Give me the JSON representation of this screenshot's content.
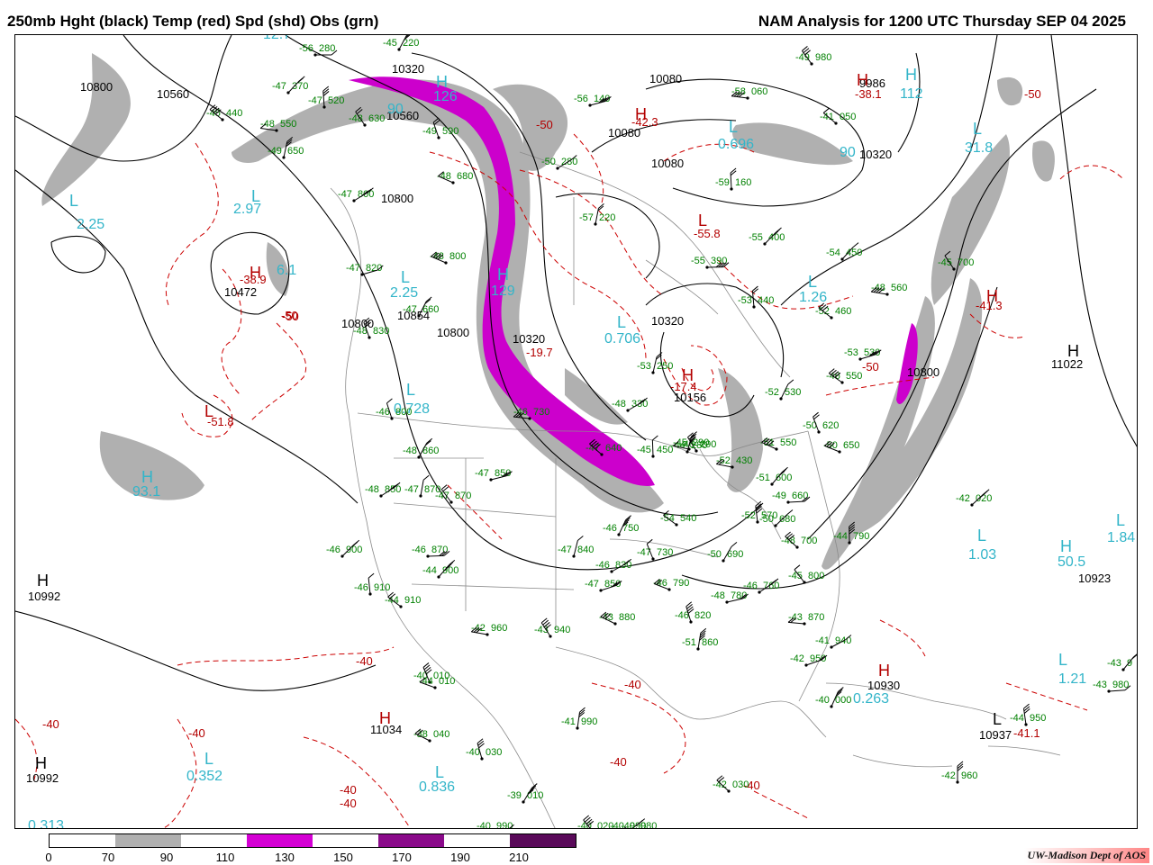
{
  "header": {
    "title_left": "250mb Hght (black) Temp (red) Spd (shd) Obs (grn)",
    "title_right": "NAM Analysis for 1200 UTC Thursday  SEP 04 2025"
  },
  "legend": {
    "ticks": [
      "0",
      "70",
      "90",
      "110",
      "130",
      "150",
      "170",
      "190",
      "210"
    ],
    "colors": [
      "#ffffff",
      "#b0b0b0",
      "#ffffff",
      "#d400d4",
      "#ffffff",
      "#8a0a8a",
      "#ffffff",
      "#5a0a5a"
    ]
  },
  "credit": "UW-Madison  Dept of AOS",
  "colors": {
    "height": "#000000",
    "temp": "#cc0000",
    "obs": "#008000",
    "cyan": "#33b5c9",
    "gray": "#b0b0b0",
    "magenta": "#cc00cc"
  },
  "height_labels": [
    "10800",
    "10560",
    "10320",
    "10560",
    "10800",
    "10472",
    "10800",
    "10854",
    "10800",
    "10320",
    "10080",
    "10080",
    "10080",
    "9986",
    "10320",
    "10156",
    "10320",
    "10800",
    "11022",
    "10923",
    "10992",
    "10930",
    "10992",
    "11034",
    "10937"
  ],
  "temp_labels": [
    "-50",
    "-42.3",
    "-55.8",
    "-38.1",
    "-41.3",
    "-50",
    "-17.4",
    "-38.9",
    "-50",
    "-50",
    "-51.8",
    "-40",
    "-40",
    "-40",
    "-40",
    "-40",
    "-40",
    "-40",
    "-41.1",
    "-40",
    "-50",
    "-19.7"
  ],
  "cyan_labels": [
    "12.7",
    "2.25",
    "2.97",
    "2.25",
    "0.728",
    "93.1",
    "0.352",
    "0.836",
    "0.313",
    "0.706",
    "0.696",
    "1.26",
    "31.8",
    "1.03",
    "50.5",
    "1.84",
    "1.21",
    "0.263",
    "126",
    "129",
    "6.1",
    "112",
    "90",
    "90"
  ],
  "obs": [
    {
      "t": "-56",
      "v": "280"
    },
    {
      "t": "-47",
      "v": "370"
    },
    {
      "t": "-47",
      "v": "520"
    },
    {
      "t": "-45",
      "v": "440"
    },
    {
      "t": "-48",
      "v": "550"
    },
    {
      "t": "-48",
      "v": "630"
    },
    {
      "t": "-49",
      "v": "650"
    },
    {
      "t": "-47",
      "v": "800"
    },
    {
      "t": "-47",
      "v": "820"
    },
    {
      "t": "-47",
      "v": "660"
    },
    {
      "t": "-48",
      "v": "830"
    },
    {
      "t": "-48",
      "v": "800"
    },
    {
      "t": "-48",
      "v": "680"
    },
    {
      "t": "-49",
      "v": "590"
    },
    {
      "t": "-45",
      "v": "220"
    },
    {
      "t": "-56",
      "v": "140"
    },
    {
      "t": "-50",
      "v": "280"
    },
    {
      "t": "-57",
      "v": "220"
    },
    {
      "t": "-49",
      "v": "980"
    },
    {
      "t": "-58",
      "v": "060"
    },
    {
      "t": "-41",
      "v": "050"
    },
    {
      "t": "-59",
      "v": "160"
    },
    {
      "t": "-55",
      "v": "400"
    },
    {
      "t": "-55",
      "v": "390"
    },
    {
      "t": "-54",
      "v": "450"
    },
    {
      "t": "-53",
      "v": "440"
    },
    {
      "t": "-52",
      "v": "460"
    },
    {
      "t": "-48",
      "v": "560"
    },
    {
      "t": "-45",
      "v": "700"
    },
    {
      "t": "-53",
      "v": "250"
    },
    {
      "t": "-48",
      "v": "330"
    },
    {
      "t": "-53",
      "v": "530"
    },
    {
      "t": "-52",
      "v": "530"
    },
    {
      "t": "-50",
      "v": "620"
    },
    {
      "t": "-50",
      "v": "650"
    },
    {
      "t": "-51",
      "v": "550"
    },
    {
      "t": "-46",
      "v": "800"
    },
    {
      "t": "-48",
      "v": "860"
    },
    {
      "t": "-47",
      "v": "850"
    },
    {
      "t": "-48",
      "v": "850"
    },
    {
      "t": "-47",
      "v": "870"
    },
    {
      "t": "-47",
      "v": "870"
    },
    {
      "t": "-46",
      "v": "730"
    },
    {
      "t": "-47",
      "v": "640"
    },
    {
      "t": "-45",
      "v": "450"
    },
    {
      "t": "-46",
      "v": "900"
    },
    {
      "t": "-46",
      "v": "870"
    },
    {
      "t": "-44",
      "v": "900"
    },
    {
      "t": "-46",
      "v": "910"
    },
    {
      "t": "-44",
      "v": "910"
    },
    {
      "t": "-42",
      "v": "960"
    },
    {
      "t": "-43",
      "v": "940"
    },
    {
      "t": "-47",
      "v": "840"
    },
    {
      "t": "-46",
      "v": "830"
    },
    {
      "t": "-47",
      "v": "850"
    },
    {
      "t": "-46",
      "v": "750"
    },
    {
      "t": "-47",
      "v": "730"
    },
    {
      "t": "-46",
      "v": "790"
    },
    {
      "t": "-43",
      "v": "880"
    },
    {
      "t": "-46",
      "v": "820"
    },
    {
      "t": "-50",
      "v": "690"
    },
    {
      "t": "-48",
      "v": "780"
    },
    {
      "t": "-46",
      "v": "760"
    },
    {
      "t": "-51",
      "v": "860"
    },
    {
      "t": "-45",
      "v": "800"
    },
    {
      "t": "-43",
      "v": "870"
    },
    {
      "t": "-48",
      "v": "700"
    },
    {
      "t": "-44",
      "v": "790"
    },
    {
      "t": "-50",
      "v": "680"
    },
    {
      "t": "-49",
      "v": "660"
    },
    {
      "t": "-51",
      "v": "600"
    },
    {
      "t": "-52",
      "v": "570"
    },
    {
      "t": "-54",
      "v": "540"
    },
    {
      "t": "-52",
      "v": "430"
    },
    {
      "t": "-46",
      "v": "290"
    },
    {
      "t": "-44",
      "v": "280"
    },
    {
      "t": "-41",
      "v": "940"
    },
    {
      "t": "-42",
      "v": "950"
    },
    {
      "t": "-40",
      "v": "000"
    },
    {
      "t": "-40",
      "v": "010"
    },
    {
      "t": "-44",
      "v": "010"
    },
    {
      "t": "-38",
      "v": "040"
    },
    {
      "t": "-40",
      "v": "030"
    },
    {
      "t": "-39",
      "v": "010"
    },
    {
      "t": "-40",
      "v": "990"
    },
    {
      "t": "-40",
      "v": "990"
    },
    {
      "t": "-41",
      "v": "990"
    },
    {
      "t": "-40",
      "v": "020"
    },
    {
      "t": "-40",
      "v": "980"
    },
    {
      "t": "-42",
      "v": "030"
    },
    {
      "t": "-42",
      "v": "960"
    },
    {
      "t": "-42",
      "v": "020"
    },
    {
      "t": "-43",
      "v": "980"
    },
    {
      "t": "-43",
      "v": "9"
    },
    {
      "t": "-44",
      "v": "950"
    },
    {
      "t": "-46",
      "v": "550"
    },
    {
      "t": "-45",
      "v": "290"
    }
  ]
}
